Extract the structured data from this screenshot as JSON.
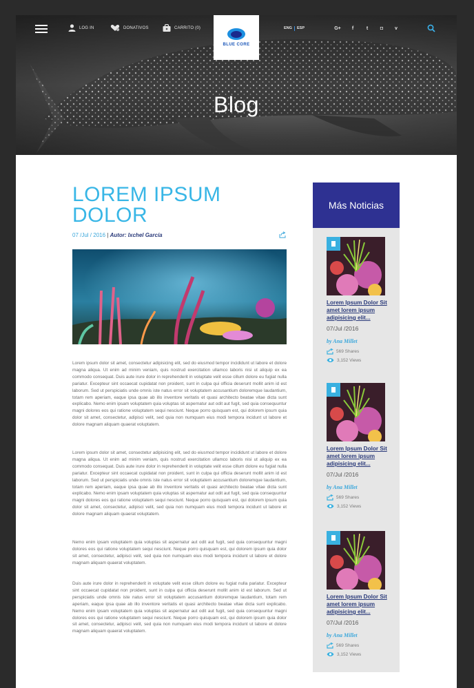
{
  "nav": {
    "login": "LOG IN",
    "donations": "DONATIVOS",
    "cart": "CARRITO (0)",
    "logo": "BLUE CORE",
    "lang_eng": "ENG",
    "lang_esp": "ESP",
    "social": [
      "google-plus-icon",
      "facebook-icon",
      "twitter-icon",
      "instagram-icon",
      "vimeo-icon"
    ],
    "social_glyphs": [
      "G+",
      "f",
      "t",
      "◘",
      "v"
    ]
  },
  "hero": {
    "title": "Blog"
  },
  "article": {
    "title": "LOREM IPSUM DOLOR",
    "date": "07 /Jul / 2016",
    "author": "Autor: Ixchel García",
    "paragraphs": [
      "Lorem ipsum dolor sit amet, consectetur adipisicing elit, sed do eiusmod tempor incididunt ut labore et dolore magna aliqua. Ut enim ad minim veniam, quis nostrud exercitation ullamco laboris nisi ut aliquip ex ea commodo consequat. Duis aute irure dolor in reprehenderit in voluptate velit esse cillum dolore eu fugiat nulla pariatur. Excepteur sint occaecat cupidatat non proident, sunt in culpa qui officia deserunt mollit anim id est laborum. Sed ut perspiciatis unde omnis iste natus error sit voluptatem accusantium doloremque laudantium, totam rem aperiam, eaque ipsa quae ab illo inventore veritatis et quasi architecto beatae vitae dicta sunt explicabo. Nemo enim ipsam voluptatem quia voluptas sit aspernatur aut odit aut fugit, sed quia consequuntur magni dolores eos qui ratione voluptatem sequi nesciunt. Neque porro quisquam est, qui dolorem ipsum quia dolor sit amet, consectetur, adipisci velit, sed quia non numquam eius modi tempora incidunt ut labore et dolore magnam aliquam quaerat voluptatem.",
      "Lorem ipsum dolor sit amet, consectetur adipisicing elit, sed do eiusmod tempor incididunt ut labore et dolore magna aliqua. Ut enim ad minim veniam, quis nostrud exercitation ullamco laboris nisi ut aliquip ex ea commodo consequat. Duis aute irure dolor in reprehenderit in voluptate velit esse cillum dolore eu fugiat nulla pariatur. Excepteur sint occaecat cupidatat non proident, sunt in culpa qui officia deserunt mollit anim id est laborum. Sed ut perspiciatis unde omnis iste natus error sit voluptatem accusantium doloremque laudantium, totam rem aperiam, eaque ipsa quae ab illo inventore veritatis et quasi architecto beatae vitae dicta sunt explicabo. Nemo enim ipsam voluptatem quia voluptas sit aspernatur aut odit aut fugit, sed quia consequuntur magni dolores eos qui ratione voluptatem sequi nesciunt. Neque porro quisquam est, qui dolorem ipsum quia dolor sit amet, consectetur, adipisci velit, sed quia non numquam eius modi tempora incidunt ut labore et dolore magnam aliquam quaerat voluptatem.",
      "Nemo enim ipsam voluptatem quia voluptas sit aspernatur aut odit aut fugit, sed quia consequuntur magni dolores eos qui ratione voluptatem sequi nesciunt. Neque porro quisquam est, qui dolorem ipsum quia dolor sit amet, consectetur, adipisci velit, sed quia non numquam eius modi tempora incidunt ut labore et dolore magnam aliquam quaerat voluptatem.",
      "Duis aute irure dolor in reprehenderit in voluptate velit esse cillum dolore eu fugiat nulla pariatur. Excepteur sint occaecat cupidatat non proident, sunt in culpa qui officia deserunt mollit anim id est laborum. Sed ut perspiciatis unde omnis iste natus error sit voluptatem accusantium doloremque laudantium, totam rem aperiam, eaque ipsa quae ab illo inventore veritatis et quasi architecto beatae vitae dicta sunt explicabo. Nemo enim ipsam voluptatem quia voluptas sit aspernatur aut odit aut fugit, sed quia consequuntur magni dolores eos qui ratione voluptatem sequi nesciunt. Neque porro quisquam est, qui dolorem ipsum quia dolor sit amet, consectetur, adipisci velit, sed quia non numquam eius modi tempora incidunt ut labore et dolore magnam aliquam quaerat voluptatem."
    ]
  },
  "sidebar": {
    "title": "Más Noticias",
    "cards": [
      {
        "title": "Lorem Ipsum Dolor Sit amet lorem ipsum adipisicing elit...",
        "date": "07/Jul /2016",
        "author": "by Ana Millet",
        "shares": "569 Shares",
        "views": "3,152 Views"
      },
      {
        "title": "Lorem Ipsum Dolor Sit amet lorem ipsum adipisicing elit...",
        "date": "07/Jul /2016",
        "author": "by Ana Millet",
        "shares": "569 Shares",
        "views": "3,152 Views"
      },
      {
        "title": "Lorem Ipsum Dolor Sit amet lorem ipsum adipisicing elit...",
        "date": "07/Jul /2016",
        "author": "by Ana Millet",
        "shares": "569 Shares",
        "views": "3,152 Views"
      }
    ]
  },
  "colors": {
    "accent": "#38b6e6",
    "brand": "#2e3192",
    "sidebar_bg": "#e6e6e6",
    "page_bg": "#2b2b2b"
  }
}
